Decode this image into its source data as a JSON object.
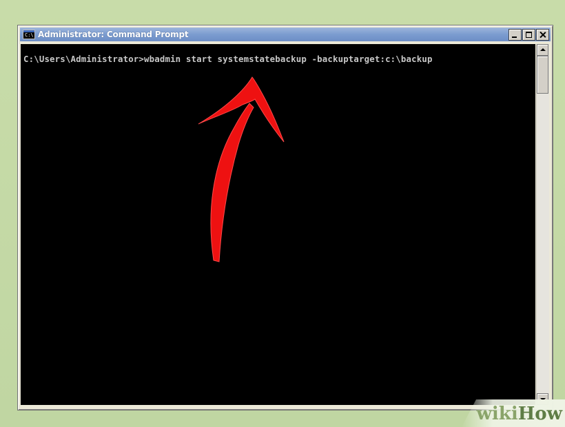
{
  "window": {
    "title": "Administrator: Command Prompt",
    "icon_label": "C:\\",
    "icon": "cmd-window-icon"
  },
  "titlebar_buttons": {
    "minimize": "minimize-icon",
    "maximize": "maximize-icon",
    "close": "close-icon"
  },
  "console": {
    "line1": "C:\\Users\\Administrator>wbadmin start systemstatebackup -backuptarget:c:\\backup"
  },
  "annotation": {
    "arrow_color": "#ee1111",
    "arrow": "red-arrow-annotation"
  },
  "watermark": {
    "part1": "wiki",
    "part2": "How"
  },
  "colors": {
    "console_bg": "#000000",
    "console_text": "#c8c8c8",
    "titlebar": "#7b9ccf"
  }
}
